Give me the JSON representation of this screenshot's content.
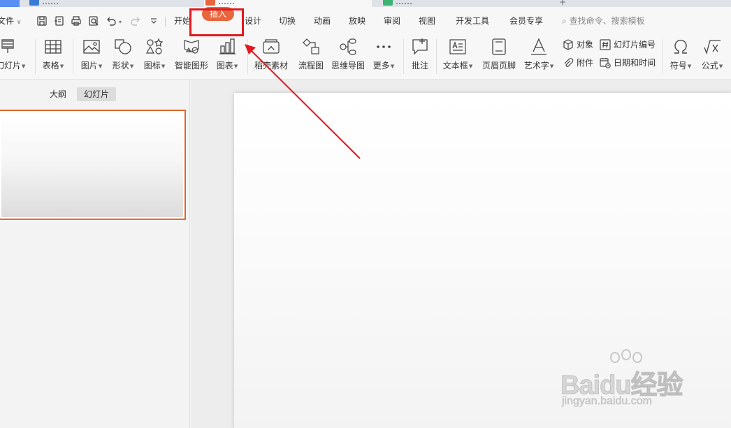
{
  "tabs": [
    {
      "label": "……",
      "color": "#3a7bd5"
    },
    {
      "label": "……",
      "color": "#e8663d"
    },
    {
      "label": "……",
      "color": "#3cb371"
    }
  ],
  "menu": {
    "file": "文件",
    "items": [
      "开始",
      "插入",
      "设计",
      "切换",
      "动画",
      "放映",
      "审阅",
      "视图",
      "开发工具",
      "会员专享"
    ],
    "active": "插入",
    "search_placeholder": "查找命令、搜索模板"
  },
  "ribbon": {
    "new_slide": "幻灯片",
    "table": "表格",
    "picture": "图片",
    "shape": "形状",
    "icon": "图标",
    "smart_graphic": "智能图形",
    "chart": "图表",
    "material": "稻壳素材",
    "flowchart": "流程图",
    "mindmap": "思维导图",
    "more": "更多",
    "comment": "批注",
    "textbox": "文本框",
    "header_footer": "页眉页脚",
    "wordart": "艺术字",
    "object": "对象",
    "slide_number": "幻灯片编号",
    "attachment": "附件",
    "date_time": "日期和时间",
    "symbol": "符号",
    "formula": "公式"
  },
  "panel": {
    "outline_tab": "大纲",
    "slides_tab": "幻灯片"
  },
  "colors": {
    "accent": "#e8663d",
    "highlight_box": "#e0191f",
    "arrow": "#e0191f"
  },
  "watermark": {
    "brand": "Baidu经验",
    "url": "jingyan.baidu.com"
  }
}
